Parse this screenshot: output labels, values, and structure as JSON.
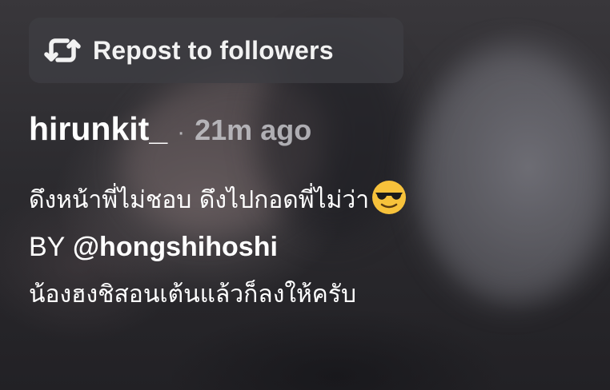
{
  "repost": {
    "label": "Repost to followers",
    "icon": "repost-icon"
  },
  "post": {
    "username": "hirunkit_",
    "separator": "·",
    "timestamp": "21m ago",
    "caption_line1": "ดึงหน้าพี่ไม่ชอบ ดึงไปกอดพี่ไม่ว่า",
    "caption_emoji": "sunglasses-emoji",
    "by_label": "BY",
    "mention": "@hongshihoshi",
    "caption_line3": "น้องฮงชิสอนเต้นแล้วก็ลงให้ครับ"
  },
  "colors": {
    "pill_background": "#3e3e42",
    "text_primary": "#ffffff",
    "text_secondary": "#cdcdd2",
    "emoji_face": "#f7c23b"
  }
}
